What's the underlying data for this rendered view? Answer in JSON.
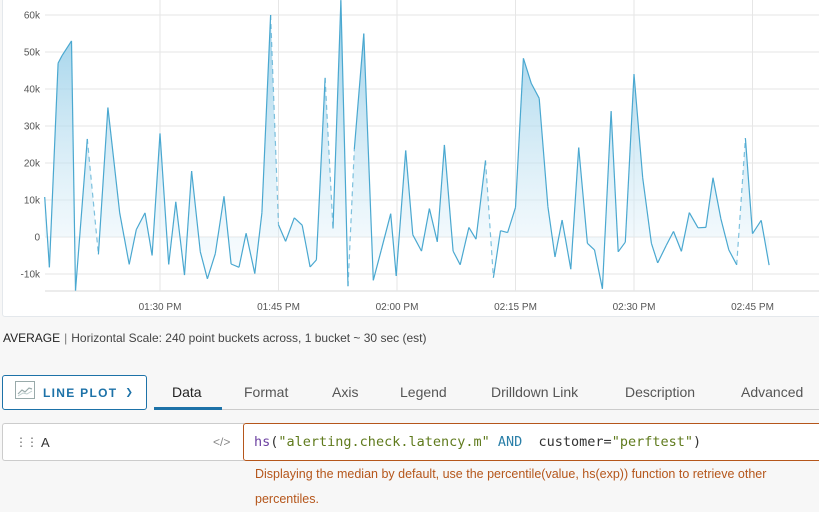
{
  "chart_data": {
    "type": "area",
    "title": "",
    "xlabel": "",
    "ylabel": "",
    "ylim": [
      -15,
      62
    ],
    "xlim_minutes_from_0130": [
      -14.6,
      83.4
    ],
    "x_tick_labels": [
      "01:30 PM",
      "01:45 PM",
      "02:00 PM",
      "02:15 PM",
      "02:30 PM",
      "02:45 PM"
    ],
    "x_tick_minutes_from_0130": [
      0,
      15,
      30,
      45,
      60,
      75
    ],
    "y_tick_labels": [
      "60k",
      "50k",
      "40k",
      "30k",
      "20k",
      "10k",
      "0",
      "-10k"
    ],
    "y_tick_values": [
      60,
      50,
      40,
      30,
      20,
      10,
      0,
      -10
    ],
    "y_unit": "thousands",
    "grid": true,
    "series": [
      {
        "name": "hs(\"alerting.check.latency.m\" AND customer=\"perftest\")",
        "color": "#4aa8d0",
        "x_minutes_from_0130": [
          -14.6,
          -14.0,
          -12.9,
          -12.4,
          -11.2,
          -10.7,
          -9.2,
          -7.8,
          -6.6,
          -5.1,
          -3.9,
          -3.0,
          -1.9,
          -1.0,
          0.0,
          1.1,
          2.0,
          3.1,
          4.0,
          5.1,
          6.0,
          7.0,
          8.1,
          9.0,
          10.0,
          10.9,
          12.0,
          12.9,
          14.0,
          15.0,
          15.9,
          17.0,
          18.0,
          19.0,
          19.8,
          20.9,
          21.9,
          22.9,
          23.8,
          24.6,
          25.8,
          27.0,
          28.0,
          29.2,
          29.9,
          31.1,
          32.0,
          33.1,
          34.1,
          35.1,
          36.0,
          37.1,
          38.0,
          39.1,
          40.0,
          41.2,
          42.2,
          43.1,
          44.0,
          45.0,
          46.0,
          47.0,
          48.0,
          49.1,
          50.0,
          50.9,
          52.0,
          53.0,
          54.1,
          55.0,
          56.0,
          57.1,
          58.0,
          58.9,
          60.0,
          61.1,
          62.2,
          63.0,
          64.1,
          65.0,
          66.0,
          67.0,
          68.1,
          69.1,
          70.0,
          71.0,
          72.0,
          73.0,
          74.1,
          75.0,
          76.1,
          77.1,
          78.0,
          79.2,
          80.0,
          81.0,
          82.1,
          83.0,
          83.4
        ],
        "values": [
          10.8,
          -8.2,
          47,
          49,
          53,
          -14.5,
          26.5,
          -4.7,
          35,
          6.5,
          -7.4,
          2,
          6.5,
          -5,
          28,
          -7.4,
          9.5,
          -10.3,
          17.8,
          -4,
          -11.3,
          -4.5,
          11,
          -7.3,
          -8.2,
          1,
          -9.9,
          6.5,
          60,
          3.3,
          -1.2,
          5.2,
          3.2,
          -8.1,
          -6.2,
          43,
          2.3,
          64,
          -13.3,
          23.7,
          55,
          -11.7,
          -3.6,
          6.3,
          -10.5,
          23.4,
          0.6,
          -3.8,
          7.7,
          -1.3,
          24.9,
          -3.8,
          -7.5,
          2.6,
          -0.6,
          20.7,
          -11,
          1.7,
          1.2,
          8,
          48.3,
          41.5,
          37.5,
          8.2,
          -5.4,
          4.6,
          -8.7,
          24.2,
          -1.7,
          -3.5,
          -14,
          34,
          -4,
          -1.4,
          44,
          16,
          -1.7,
          -7,
          -2.2,
          1.5,
          -3.9,
          6.6,
          2.5,
          2.6,
          16,
          4.9,
          -3.5,
          -7.5,
          26.7,
          0.9,
          4.5,
          -7.6
        ],
        "dashed_gap_segments_after_index": [
          6,
          28,
          35,
          38,
          55,
          87
        ]
      }
    ]
  },
  "summary": {
    "aggregation": "AVERAGE",
    "separator": "|",
    "scale_text": "Horizontal Scale: 240 point buckets across, 1 bucket ~ 30 sec (est)"
  },
  "toolbar": {
    "chart_type_label": "LINE PLOT",
    "chart_type_icon": "line-chart-icon",
    "chevron_icon": "chevron-down-icon",
    "tabs": [
      {
        "label": "Data",
        "active": true
      },
      {
        "label": "Format",
        "active": false
      },
      {
        "label": "Axis",
        "active": false
      },
      {
        "label": "Legend",
        "active": false
      },
      {
        "label": "Drilldown Link",
        "active": false
      },
      {
        "label": "Description",
        "active": false
      },
      {
        "label": "Advanced",
        "active": false
      }
    ],
    "accent_color": "#1d72a8"
  },
  "query": {
    "drag_icon": "drag-handle-icon",
    "name": "A",
    "code_toggle": "</>",
    "tokens": [
      {
        "type": "fn",
        "text": "hs"
      },
      {
        "type": "punc",
        "text": "("
      },
      {
        "type": "str",
        "text": "\"alerting.check.latency.m\""
      },
      {
        "type": "id",
        "text": " "
      },
      {
        "type": "kw",
        "text": "AND"
      },
      {
        "type": "id",
        "text": "  customer"
      },
      {
        "type": "punc",
        "text": "="
      },
      {
        "type": "str",
        "text": "\"perftest\""
      },
      {
        "type": "punc",
        "text": ")"
      }
    ],
    "warning": "Displaying the median by default, use the percentile(value, hs(exp)) function to retrieve other percentiles.",
    "warning_color": "#b5561b"
  }
}
